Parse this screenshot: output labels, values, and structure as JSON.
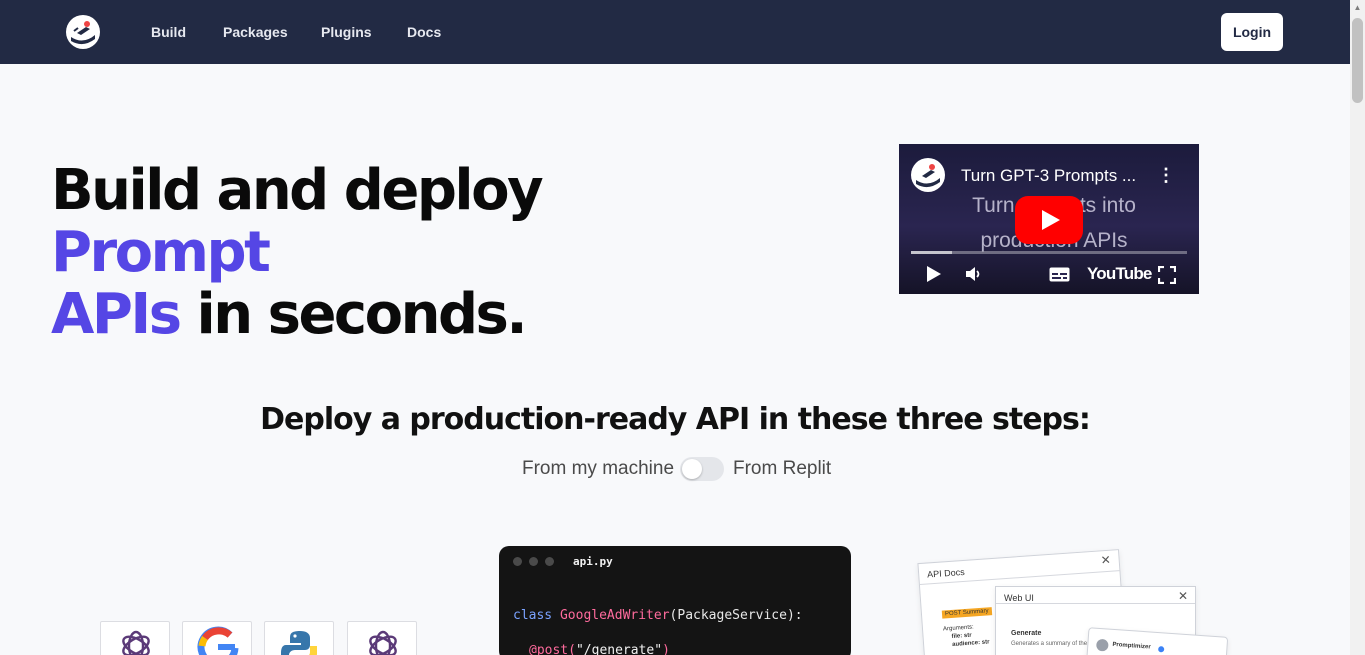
{
  "nav": {
    "links": [
      "Build",
      "Packages",
      "Plugins",
      "Docs"
    ],
    "login": "Login"
  },
  "hero": {
    "line1_plain": "Build and deploy ",
    "line1_accent": "Prompt",
    "line2_accent": "APIs",
    "line2_plain": " in seconds.",
    "accent_color": "#5546e5"
  },
  "video": {
    "title": "Turn GPT-3 Prompts ...",
    "overlay_line1": "Turn prompts into",
    "overlay_line2": "production APIs",
    "brand": "YouTube",
    "progress": 0.15
  },
  "steps": {
    "heading": "Deploy a production-ready API in these three steps:",
    "toggle_left": "From my machine",
    "toggle_right": "From Replit",
    "toggle_on": false
  },
  "code": {
    "filename": "api.py",
    "line1_kw": "class ",
    "line1_name": "GoogleAdWriter",
    "line1_rest": "(PackageService):",
    "line2_dec": "@post(",
    "line2_str": "\"/generate\"",
    "line2_end": ")"
  },
  "panels": {
    "api_docs_title": "API Docs",
    "api_docs_badge": "POST  Summary",
    "api_docs_args": "Arguments:",
    "api_docs_file": "file: str",
    "api_docs_audience": "audience: str",
    "web_ui_title": "Web UI",
    "web_ui_heading": "Generate",
    "web_ui_desc": "Generates a summary of the",
    "chat_user": "Promptimizer"
  },
  "icons": [
    "rocket-logo-icon",
    "openai-icon",
    "google-icon",
    "python-icon",
    "play-icon",
    "volume-icon",
    "subtitles-icon",
    "fullscreen-icon",
    "more-vert-icon",
    "close-icon"
  ]
}
